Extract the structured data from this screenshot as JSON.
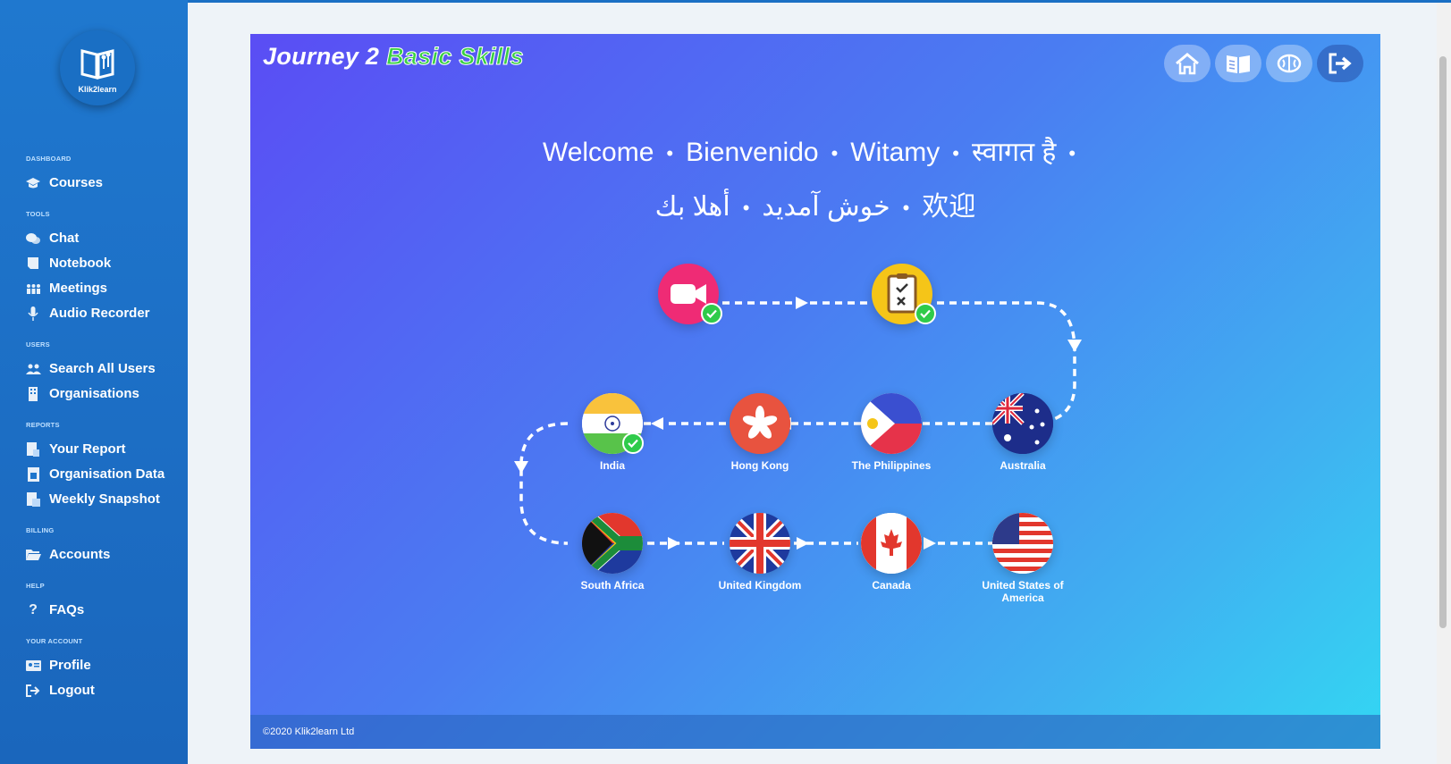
{
  "sidebar": {
    "logo_text": "Klik2learn",
    "sections": [
      {
        "title": "DASHBOARD",
        "items": [
          {
            "label": "Courses",
            "icon": "graduation-cap-icon"
          }
        ]
      },
      {
        "title": "TOOLS",
        "items": [
          {
            "label": "Chat",
            "icon": "chat-icon"
          },
          {
            "label": "Notebook",
            "icon": "notebook-icon"
          },
          {
            "label": "Meetings",
            "icon": "meetings-icon"
          },
          {
            "label": "Audio Recorder",
            "icon": "microphone-icon"
          }
        ]
      },
      {
        "title": "USERS",
        "items": [
          {
            "label": "Search All Users",
            "icon": "users-icon"
          },
          {
            "label": "Organisations",
            "icon": "building-icon"
          }
        ]
      },
      {
        "title": "REPORTS",
        "items": [
          {
            "label": "Your Report",
            "icon": "report-icon"
          },
          {
            "label": "Organisation Data",
            "icon": "org-data-icon"
          },
          {
            "label": "Weekly Snapshot",
            "icon": "snapshot-icon"
          }
        ]
      },
      {
        "title": "BILLING",
        "items": [
          {
            "label": "Accounts",
            "icon": "folder-icon"
          }
        ]
      },
      {
        "title": "HELP",
        "items": [
          {
            "label": "FAQs",
            "icon": "question-icon"
          }
        ]
      },
      {
        "title": "YOUR ACCOUNT",
        "items": [
          {
            "label": "Profile",
            "icon": "id-card-icon"
          },
          {
            "label": "Logout",
            "icon": "logout-icon"
          }
        ]
      }
    ]
  },
  "panel": {
    "title_part1": "Journey 2 ",
    "title_part2": "Basic Skills",
    "welcome_line1": [
      "Welcome",
      "Bienvenido",
      "Witamy",
      "स्वागत है"
    ],
    "welcome_line2": [
      "خوش آمدید",
      "أهلا بك",
      "欢迎"
    ],
    "footer": "©2020 Klik2learn Ltd",
    "top_buttons": [
      "home-icon",
      "book-icon",
      "brain-icon",
      "exit-icon"
    ]
  },
  "journey": {
    "steps": [
      {
        "name": "video",
        "completed": true
      },
      {
        "name": "quiz",
        "completed": true
      }
    ],
    "countries": [
      {
        "label": "Australia",
        "completed": false
      },
      {
        "label": "The Philippines",
        "completed": false
      },
      {
        "label": "Hong Kong",
        "completed": false
      },
      {
        "label": "India",
        "completed": true
      },
      {
        "label": "South Africa",
        "completed": false
      },
      {
        "label": "United Kingdom",
        "completed": false
      },
      {
        "label": "Canada",
        "completed": false
      },
      {
        "label": "United States of America",
        "completed": false
      }
    ]
  },
  "colors": {
    "sidebar": "#1f78cf",
    "accent_green": "#39d141",
    "check_green": "#2fcb4a"
  }
}
